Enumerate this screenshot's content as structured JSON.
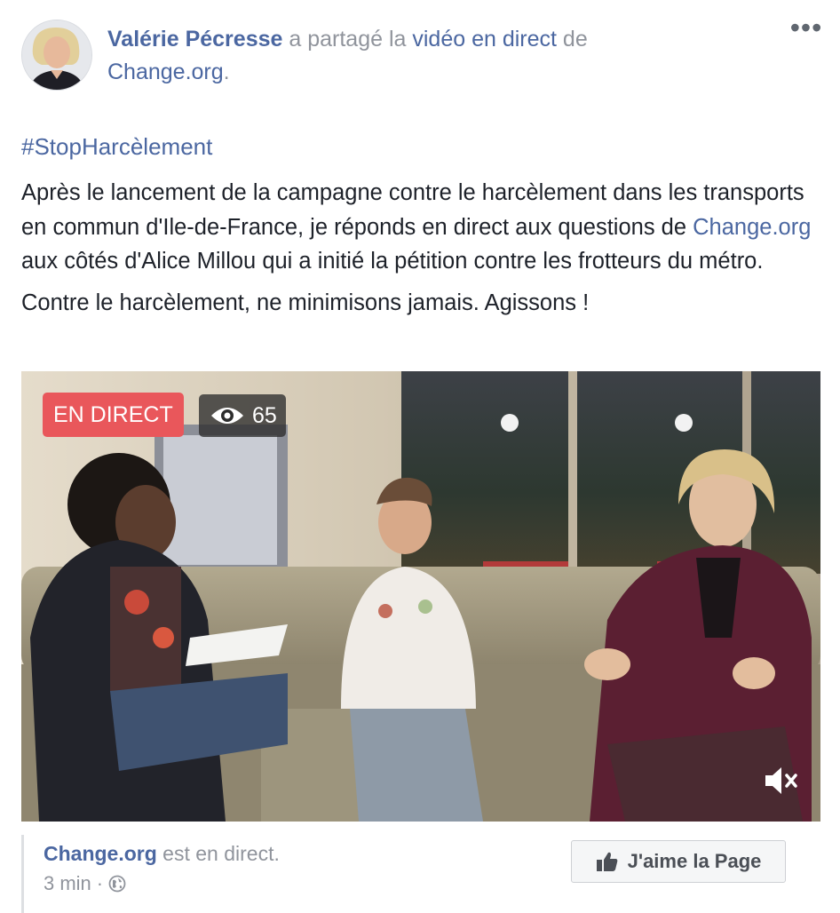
{
  "post": {
    "author": "Valérie Pécresse",
    "shared_text": "a partagé la",
    "video_link": "vidéo en direct",
    "de_text": "de",
    "source_page": "Change.org",
    "period": ".",
    "more_label": "•••",
    "hashtag": "#StopHarcèlement",
    "body_part1": "Après le lancement de la campagne contre le harcèlement dans les transports en commun d'Ile-de-France, je réponds en direct aux questions de ",
    "body_link": "Change.org",
    "body_part2": " aux côtés d'Alice Millou qui a initié la pétition contre les frotteurs du métro.",
    "body_line2": "Contre le harcèlement, ne minimisons jamais. Agissons !"
  },
  "video": {
    "live_label": "EN DIRECT",
    "viewers": "65",
    "mute_icon": "speaker-muted-icon"
  },
  "source": {
    "page_name": "Change.org",
    "status": " est en direct.",
    "time": "3 min",
    "separator": "·",
    "privacy_icon": "globe-icon",
    "like_label": "J'aime la Page",
    "like_icon": "thumbs-up-icon"
  },
  "colors": {
    "link": "#4b67a1",
    "live_badge": "#e9575b",
    "meta_gray": "#90949c"
  }
}
